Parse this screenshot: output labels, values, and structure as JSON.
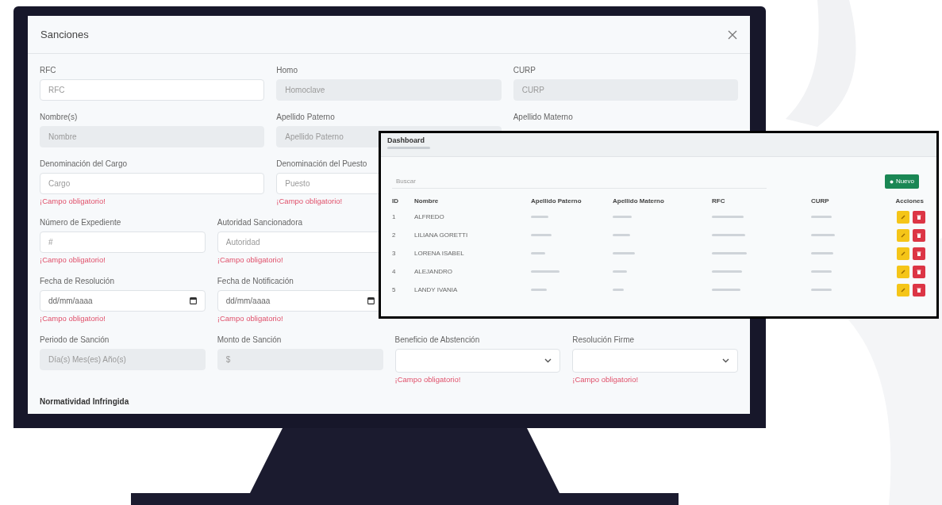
{
  "dialog": {
    "title": "Sanciones"
  },
  "form": {
    "rows": [
      {
        "fields": [
          {
            "kind": "text",
            "label": "RFC",
            "placeholder": "RFC",
            "disabled": false
          },
          {
            "kind": "text",
            "label": "Homo",
            "placeholder": "Homoclave",
            "disabled": true
          },
          {
            "kind": "text",
            "label": "CURP",
            "placeholder": "CURP",
            "disabled": true
          }
        ]
      },
      {
        "fields": [
          {
            "kind": "text",
            "label": "Nombre(s)",
            "placeholder": "Nombre",
            "disabled": true
          },
          {
            "kind": "text",
            "label": "Apellido Paterno",
            "placeholder": "Apellido Paterno",
            "disabled": true
          },
          {
            "kind": "label_only",
            "label": "Apellido Materno"
          }
        ]
      },
      {
        "fields": [
          {
            "kind": "text",
            "label": "Denominación del Cargo",
            "placeholder": "Cargo",
            "disabled": false,
            "error": "¡Campo obligatorio!"
          },
          {
            "kind": "text",
            "label": "Denominación del Puesto",
            "placeholder": "Puesto",
            "disabled": false,
            "error": "¡Campo obligatorio!"
          },
          {
            "kind": "covered"
          }
        ]
      },
      {
        "fields": [
          {
            "kind": "text",
            "label": "Número de Expediente",
            "placeholder": "#",
            "disabled": false,
            "error": "¡Campo obligatorio!"
          },
          {
            "kind": "text",
            "label": "Autoridad Sancionadora",
            "placeholder": "Autoridad",
            "disabled": false,
            "error": "¡Campo obligatorio!"
          },
          {
            "kind": "covered"
          },
          {
            "kind": "covered"
          }
        ]
      },
      {
        "fields": [
          {
            "kind": "date",
            "label": "Fecha de Resolución",
            "placeholder": "dd/mm/aaaa",
            "disabled": false,
            "error": "¡Campo obligatorio!"
          },
          {
            "kind": "date",
            "label": "Fecha de Notificación",
            "placeholder": "dd/mm/aaaa",
            "disabled": false,
            "error": "¡Campo obligatorio!"
          },
          {
            "kind": "covered"
          },
          {
            "kind": "covered"
          }
        ]
      },
      {
        "fields": [
          {
            "kind": "text",
            "label": "Periodo de Sanción",
            "placeholder": "Día(s) Mes(es) Año(s)",
            "disabled": true
          },
          {
            "kind": "text",
            "label": "Monto de Sanción",
            "placeholder": "$",
            "disabled": true
          },
          {
            "kind": "select",
            "label": "Beneficio de Abstención",
            "disabled": false,
            "error": "¡Campo obligatorio!"
          },
          {
            "kind": "select",
            "label": "Resolución Firme",
            "disabled": false,
            "error": "¡Campo obligatorio!"
          }
        ]
      }
    ],
    "section_title": "Normatividad Infringida"
  },
  "dashboard": {
    "title": "Dashboard",
    "search": {
      "placeholder": "Buscar"
    },
    "new_button": "Nuevo",
    "columns": [
      "ID",
      "Nombre",
      "Apellido Paterno",
      "Apellido Materno",
      "RFC",
      "CURP",
      "Acciones"
    ],
    "rows": [
      {
        "id": "1",
        "name": "ALFREDO"
      },
      {
        "id": "2",
        "name": "LILIANA GORETTI"
      },
      {
        "id": "3",
        "name": "LORENA ISABEL"
      },
      {
        "id": "4",
        "name": "ALEJANDRO"
      },
      {
        "id": "5",
        "name": "LANDY IVANIA"
      }
    ]
  }
}
